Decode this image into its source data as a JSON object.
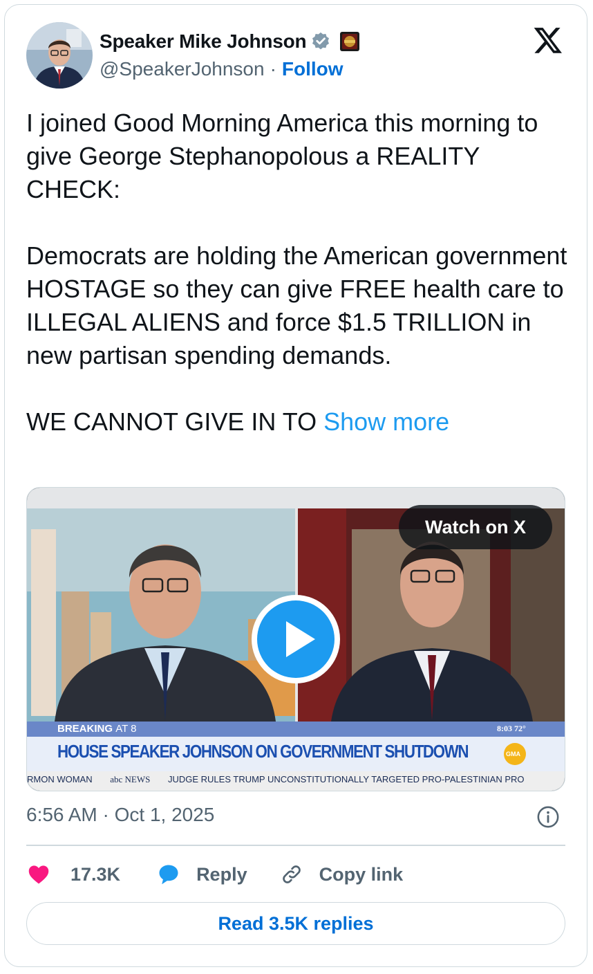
{
  "author": {
    "name": "Speaker Mike Johnson",
    "handle": "@SpeakerJohnson",
    "separator": "·",
    "follow_label": "Follow",
    "verified_icon": "verified-badge-icon",
    "affiliation_icon": "affiliation-badge-icon"
  },
  "tweet": {
    "text": "I joined Good Morning America this morning to give George Stephanopolous a REALITY CHECK:\n\nDemocrats are holding the American government HOSTAGE so they can give FREE health care to ILLEGAL ALIENS and force $1.5 TRILLION in new partisan spending demands.\n\nWE CANNOT GIVE IN TO ",
    "show_more_label": "Show more"
  },
  "media": {
    "watch_label": "Watch on X",
    "breaking": "BREAKING",
    "breaking_time": "AT 8",
    "clock": "8:03",
    "temperature": "72°",
    "headline": "HOUSE SPEAKER JOHNSON ON GOVERNMENT SHUTDOWN",
    "network_logo": "GMA",
    "ticker_left": "RMON WOMAN",
    "ticker_network": "abc NEWS",
    "ticker_right": "JUDGE RULES TRUMP UNCONSTITUTIONALLY TARGETED PRO-PALESTINIAN PRO"
  },
  "meta": {
    "timestamp": "6:56 AM · Oct 1, 2025"
  },
  "actions": {
    "like_count": "17.3K",
    "reply_label": "Reply",
    "copy_label": "Copy link"
  },
  "read_replies_label": "Read 3.5K replies",
  "colors": {
    "accent": "#1d9bf0",
    "link": "#006fd6",
    "like": "#f91880",
    "text": "#0f1419",
    "muted": "#536471",
    "border": "#cfd9de"
  }
}
